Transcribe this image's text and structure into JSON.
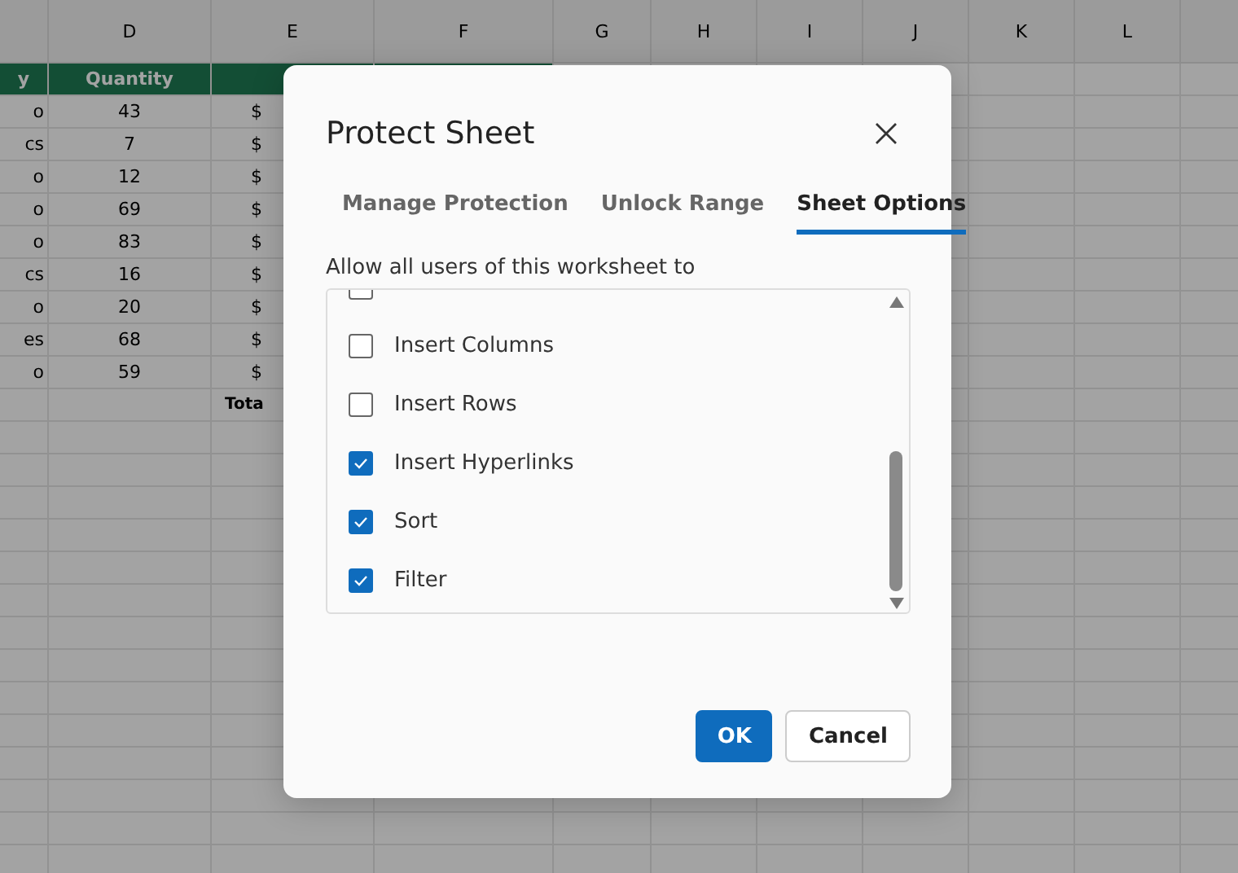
{
  "spreadsheet": {
    "column_letters": [
      "D",
      "E",
      "F",
      "G",
      "H",
      "I",
      "J",
      "K",
      "L"
    ],
    "header": [
      "y",
      "Quantity"
    ],
    "rows": [
      [
        "o",
        "43",
        "$"
      ],
      [
        "cs",
        "7",
        "$"
      ],
      [
        "o",
        "12",
        "$"
      ],
      [
        "o",
        "69",
        "$"
      ],
      [
        "o",
        "83",
        "$"
      ],
      [
        "cs",
        "16",
        "$"
      ],
      [
        "o",
        "20",
        "$"
      ],
      [
        "es",
        "68",
        "$"
      ],
      [
        "o",
        "59",
        "$"
      ]
    ],
    "total_label": "Tota"
  },
  "dialog": {
    "title": "Protect Sheet",
    "tabs": [
      {
        "label": "Manage Protection",
        "selected": false
      },
      {
        "label": "Unlock Range",
        "selected": false
      },
      {
        "label": "Sheet Options",
        "selected": true
      }
    ],
    "prompt": "Allow all users of this worksheet to",
    "options": [
      {
        "checked": false
      },
      {
        "label": "Insert Columns",
        "checked": false
      },
      {
        "label": "Insert Rows",
        "checked": false
      },
      {
        "label": "Insert Hyperlinks",
        "checked": true
      },
      {
        "label": "Sort",
        "checked": true
      },
      {
        "label": "Filter",
        "checked": true
      }
    ],
    "buttons": [
      {
        "label": "OK",
        "kind": "primary"
      },
      {
        "label": "Cancel",
        "kind": "secondary"
      }
    ]
  }
}
